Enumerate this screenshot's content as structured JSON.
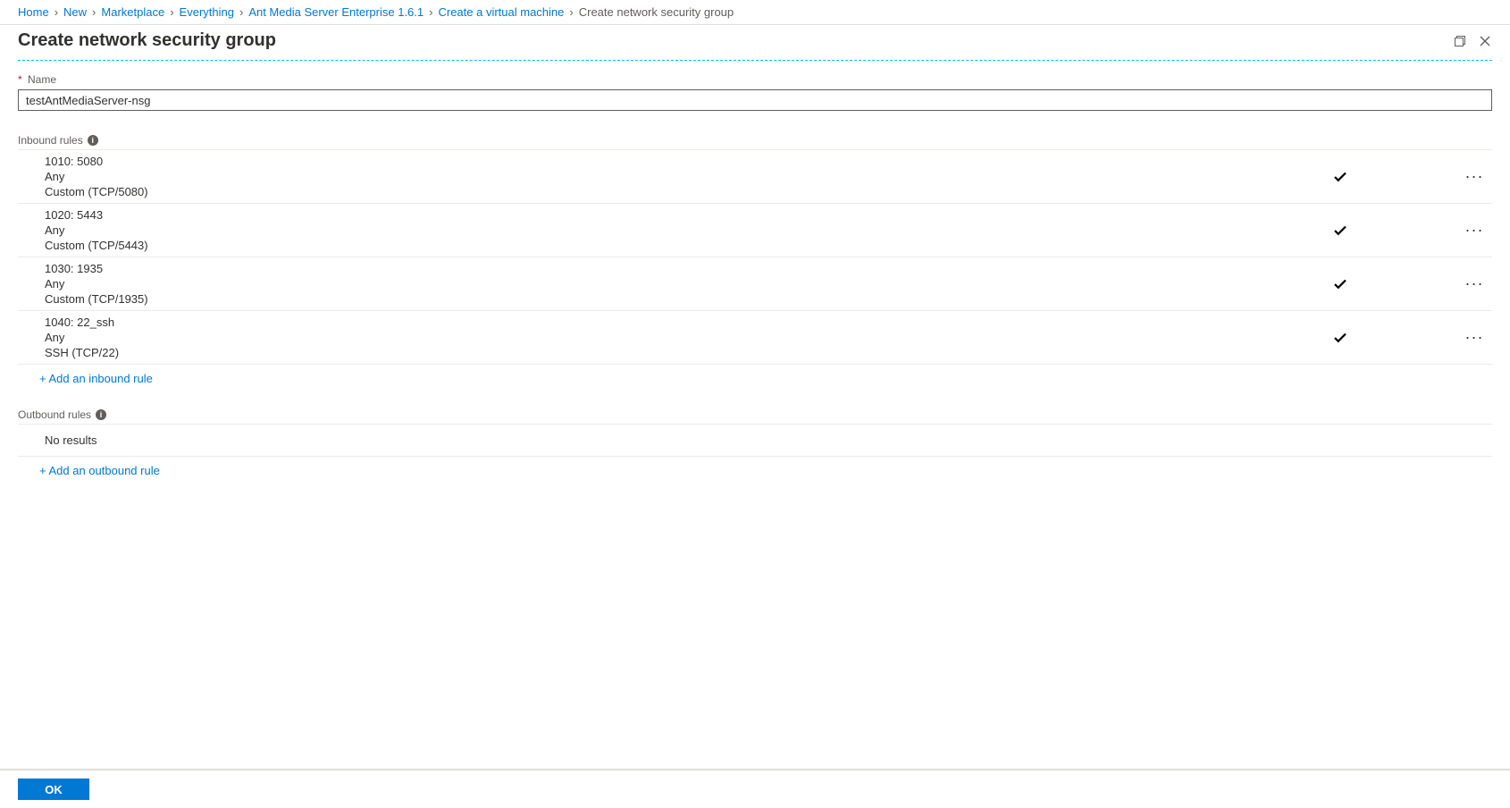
{
  "breadcrumbs": [
    {
      "label": "Home",
      "link": true
    },
    {
      "label": "New",
      "link": true
    },
    {
      "label": "Marketplace",
      "link": true
    },
    {
      "label": "Everything",
      "link": true
    },
    {
      "label": "Ant Media Server Enterprise 1.6.1",
      "link": true
    },
    {
      "label": "Create a virtual machine",
      "link": true
    },
    {
      "label": "Create network security group",
      "link": false
    }
  ],
  "header": {
    "title": "Create network security group"
  },
  "form": {
    "name_label": "Name",
    "name_value": "testAntMediaServer-nsg"
  },
  "sections": {
    "inbound_title": "Inbound rules",
    "info_char": "i",
    "outbound_title": "Outbound rules",
    "no_results": "No results"
  },
  "inbound_rules": [
    {
      "line1": "1010: 5080",
      "line2": "Any",
      "line3": "Custom (TCP/5080)"
    },
    {
      "line1": "1020: 5443",
      "line2": "Any",
      "line3": "Custom (TCP/5443)"
    },
    {
      "line1": "1030: 1935",
      "line2": "Any",
      "line3": "Custom (TCP/1935)"
    },
    {
      "line1": "1040: 22_ssh",
      "line2": "Any",
      "line3": "SSH (TCP/22)"
    }
  ],
  "links": {
    "add_inbound": "+ Add an inbound rule",
    "add_outbound": "+ Add an outbound rule"
  },
  "footer": {
    "ok": "OK"
  }
}
